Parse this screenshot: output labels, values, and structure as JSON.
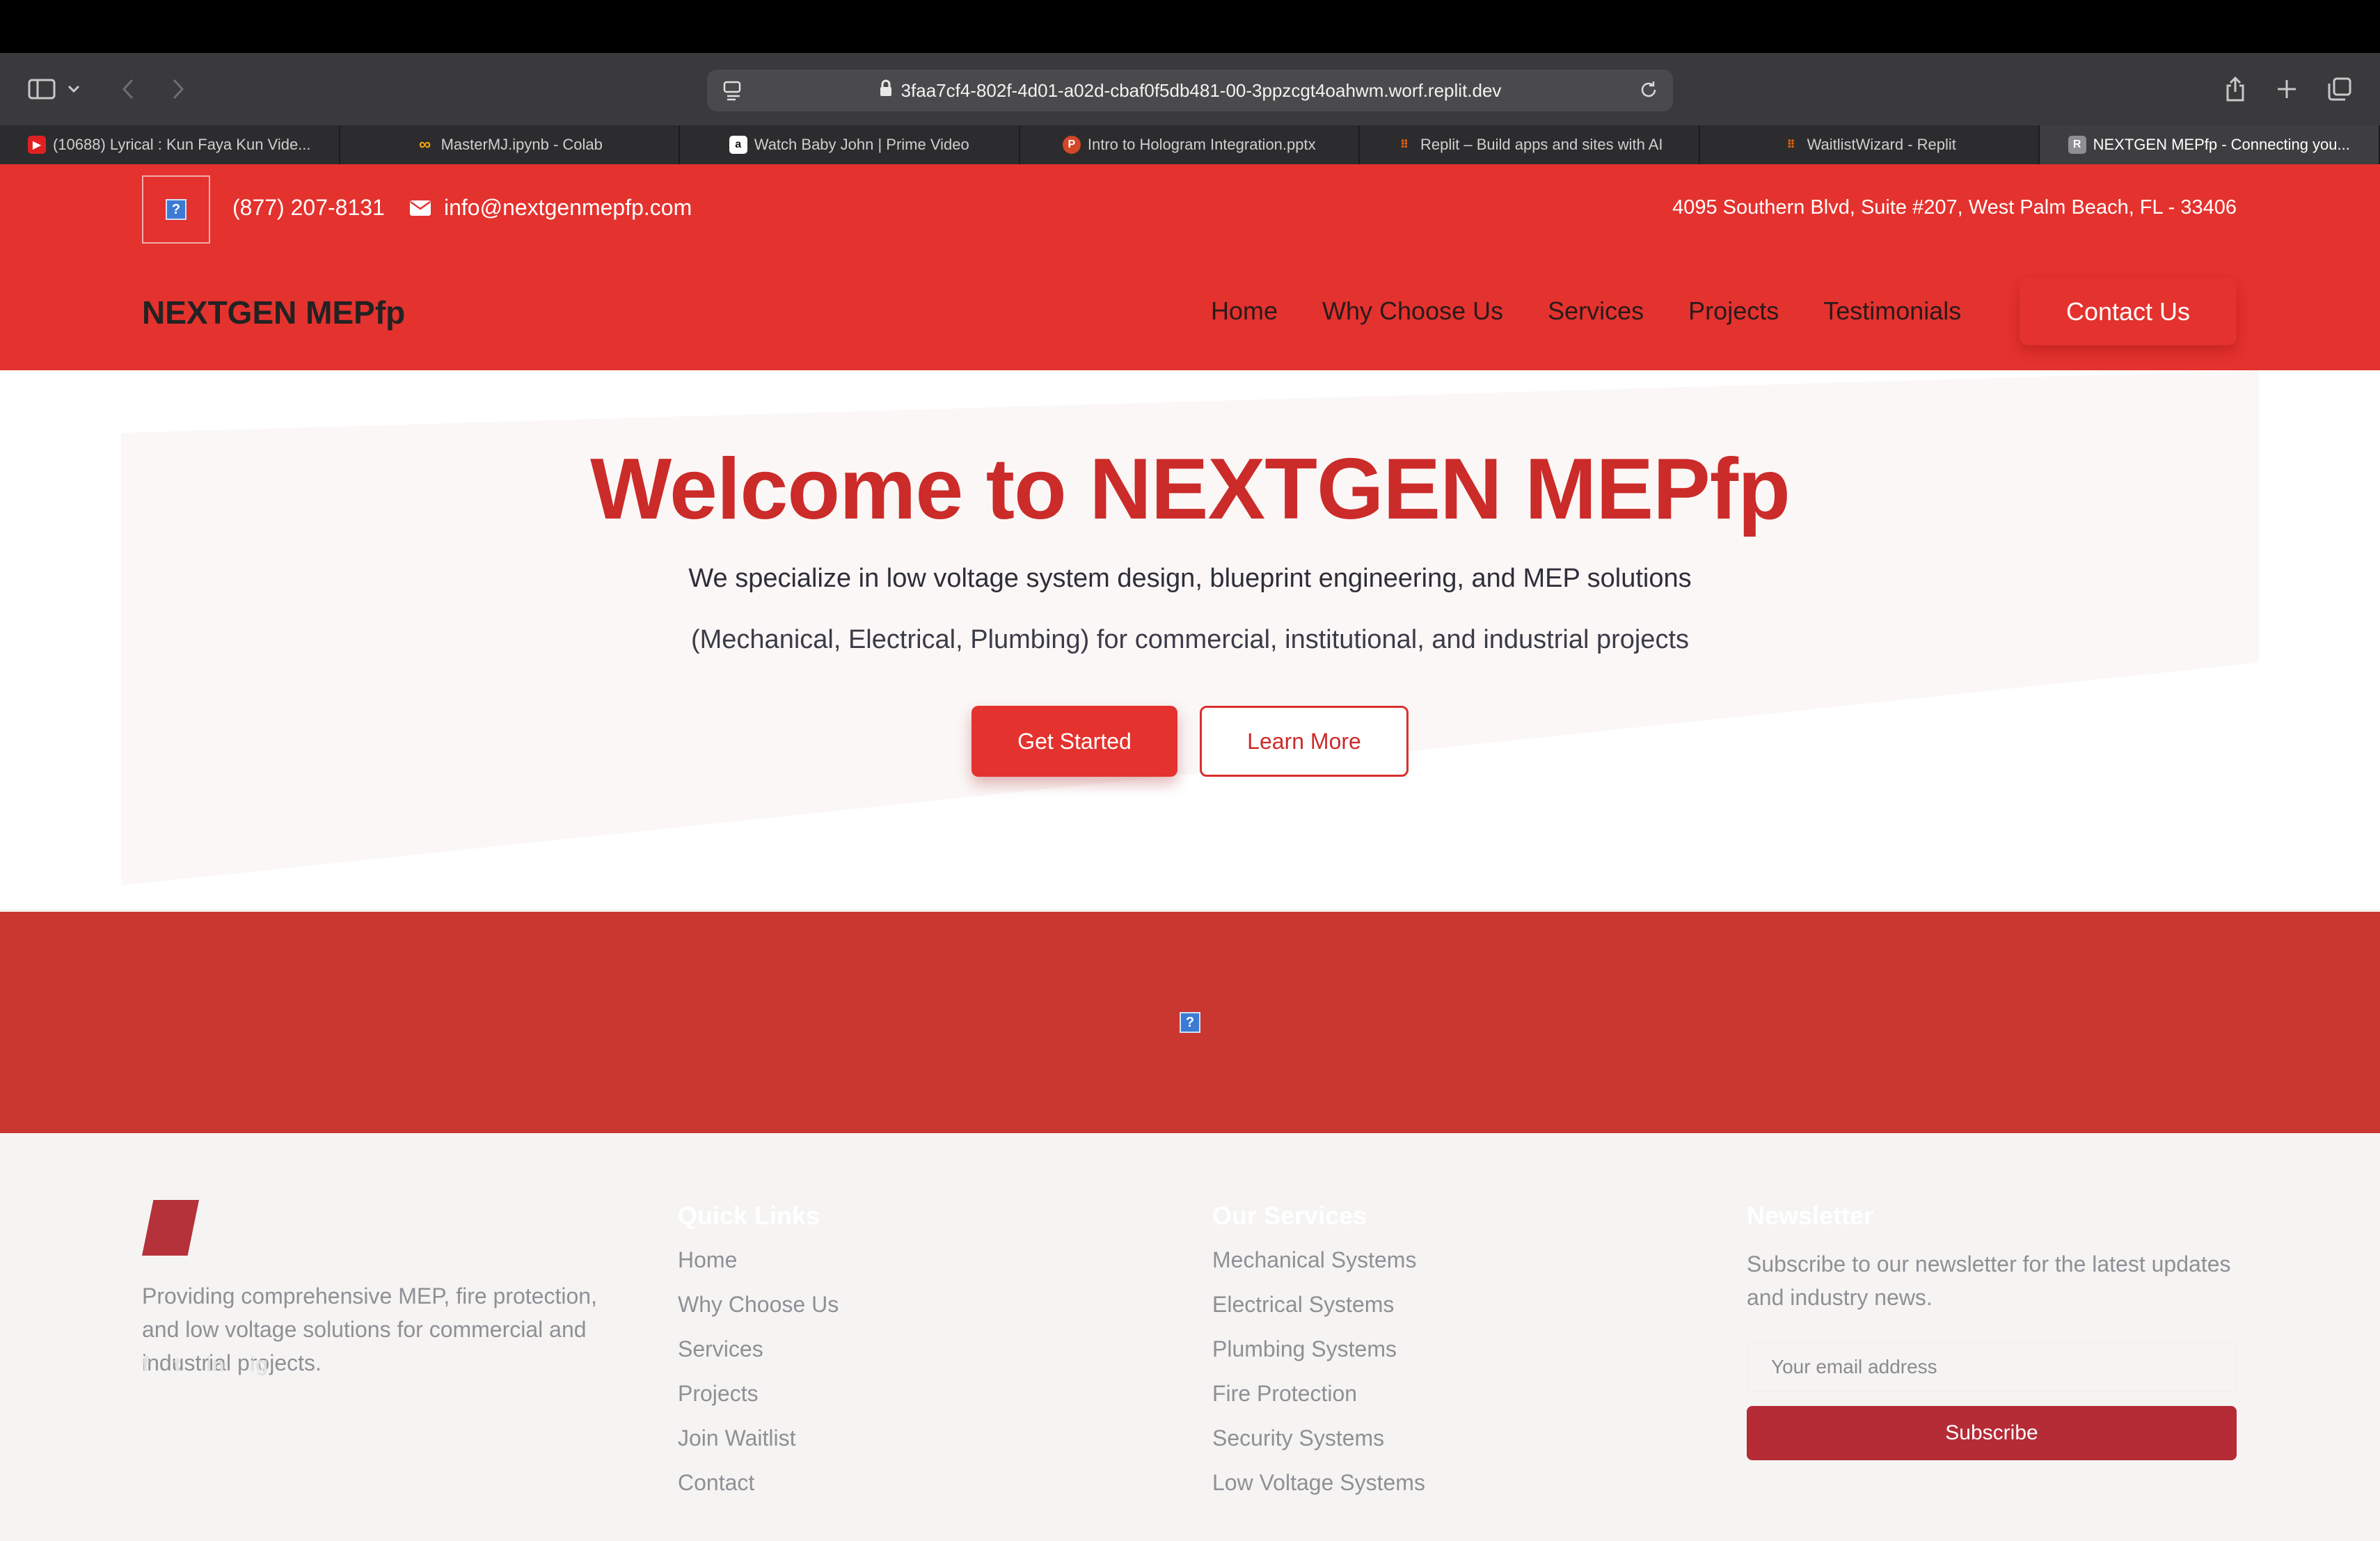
{
  "browser": {
    "url": "3faa7cf4-802f-4d01-a02d-cbaf0f5db481-00-3ppzcgt4oahwm.worf.replit.dev",
    "tabs": [
      {
        "label": "(10688) Lyrical : Kun Faya Kun Vide...",
        "icon": "youtube-icon",
        "color": "#e02020"
      },
      {
        "label": "MasterMJ.ipynb - Colab",
        "icon": "colab-icon",
        "color": "#f2a60c"
      },
      {
        "label": "Watch Baby John | Prime Video",
        "icon": "amazon-icon",
        "color": "#ffffff"
      },
      {
        "label": "Intro to Hologram Integration.pptx",
        "icon": "powerpoint-icon",
        "color": "#d24726"
      },
      {
        "label": "Replit – Build apps and sites with AI",
        "icon": "replit-icon",
        "color": "#f26207"
      },
      {
        "label": "WaitlistWizard - Replit",
        "icon": "replit-icon",
        "color": "#f26207"
      },
      {
        "label": "NEXTGEN MEPfp - Connecting you...",
        "icon": "r-icon",
        "color": "#8e8e93",
        "letter": "R"
      }
    ]
  },
  "topbar": {
    "phone": "(877) 207-8131",
    "email": "info@nextgenmepfp.com",
    "address": "4095 Southern Blvd, Suite #207, West Palm Beach, FL - 33406",
    "broken_image_glyph": "?"
  },
  "header": {
    "brand": "NEXTGEN MEPfp",
    "nav": [
      "Home",
      "Why Choose Us",
      "Services",
      "Projects",
      "Testimonials"
    ],
    "cta": "Contact Us"
  },
  "hero": {
    "title": "Welcome to NEXTGEN MEPfp",
    "subtitle_line1": "We specialize in low voltage system design, blueprint engineering, and MEP solutions",
    "subtitle_line2": "(Mechanical, Electrical, Plumbing) for commercial, institutional, and industrial projects",
    "primary_button": "Get Started",
    "secondary_button": "Learn More"
  },
  "band": {
    "broken_image_glyph": "?"
  },
  "footer": {
    "description": "Providing comprehensive MEP, fire protection, and low voltage solutions for commercial and industrial projects.",
    "socials": [
      "f",
      "t",
      "in",
      "ig"
    ],
    "quick_links_title": "Quick Links",
    "quick_links": [
      "Home",
      "Why Choose Us",
      "Services",
      "Projects",
      "Join Waitlist",
      "Contact"
    ],
    "services_title": "Our Services",
    "services": [
      "Mechanical Systems",
      "Electrical Systems",
      "Plumbing Systems",
      "Fire Protection",
      "Security Systems",
      "Low Voltage Systems"
    ],
    "newsletter_title": "Newsletter",
    "newsletter_text": "Subscribe to our newsletter for the latest updates and industry news.",
    "email_placeholder": "Your email address",
    "subscribe_label": "Subscribe"
  },
  "colors": {
    "brand_red": "#e4322e",
    "title_red": "#cb2b29",
    "band_red": "#c93730",
    "subscribe_red": "#b52b36"
  }
}
